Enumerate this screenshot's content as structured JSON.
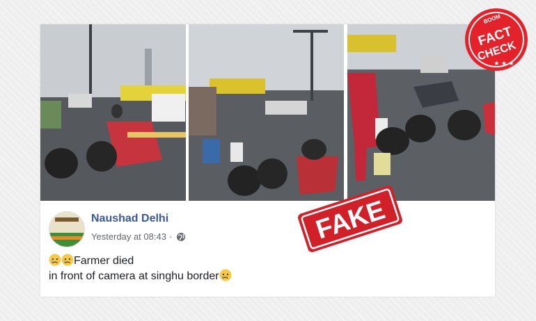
{
  "post": {
    "author": "Naushad Delhi",
    "timestamp": "Yesterday at 08:43",
    "separator": "·",
    "text_line1": "Farmer died",
    "text_line2": "in front of camera at singhu border",
    "privacy_icon": "globe-icon",
    "emoji_icon": "crying-face-emoji"
  },
  "stamp": {
    "fake_label": "FAKE"
  },
  "badge": {
    "brand": "BOOM",
    "line1": "FACT",
    "line2": "CHECK"
  },
  "colors": {
    "author_blue": "#385898",
    "stamp_red": "#d0212a",
    "badge_red": "#e3222b"
  }
}
